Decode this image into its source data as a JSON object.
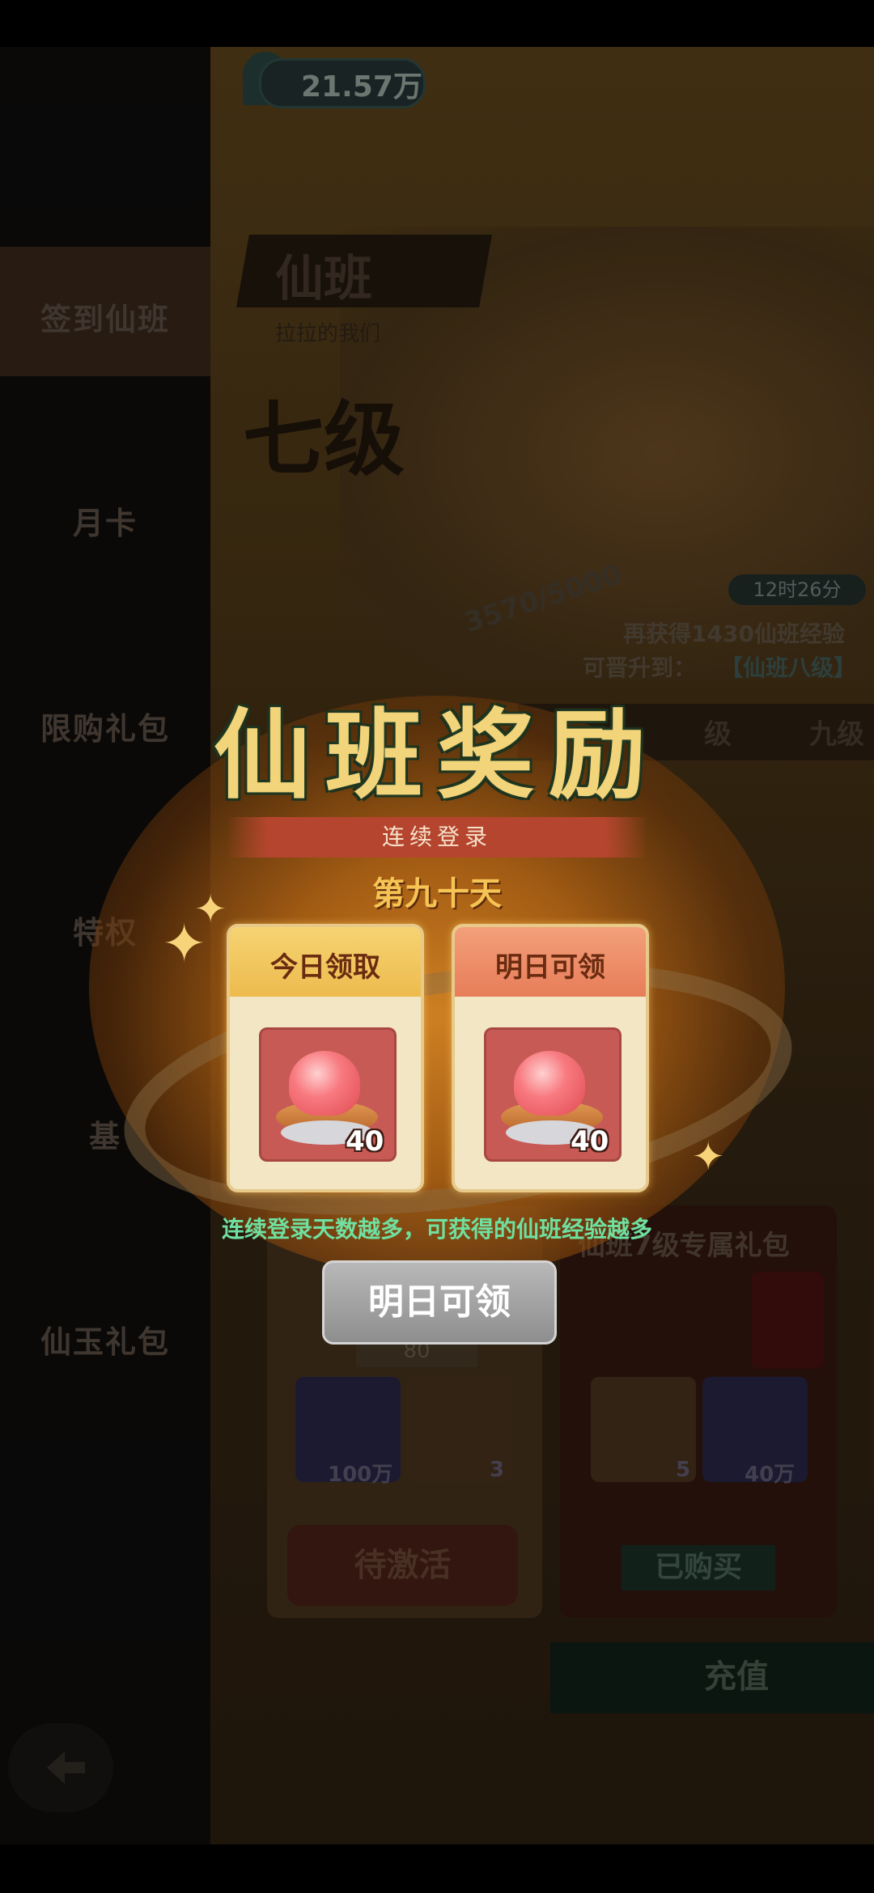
{
  "currency": {
    "value": "21.57万",
    "icon": "spiral-icon"
  },
  "sidebar": {
    "items": [
      {
        "label": "签到仙班"
      },
      {
        "label": "月卡"
      },
      {
        "label": "限购礼包"
      },
      {
        "label": "特权"
      },
      {
        "label": "基"
      },
      {
        "label": "仙玉礼包"
      }
    ]
  },
  "hero": {
    "badge": "仙班",
    "subtitle": "拉拉的我们",
    "level": "七级",
    "progress": "3570/5000",
    "timer": "12时26分",
    "exp_line": "再获得1430仙班经验",
    "promo_line": "可晋升到：",
    "promo_target": "【仙班八级】"
  },
  "tabs": {
    "eight": "级",
    "nine": "九级"
  },
  "panels": {
    "right_title": "仙班7级专属礼包",
    "left_price": "80",
    "tiles": [
      {
        "label": "100万"
      },
      {
        "label": "3"
      },
      {
        "label": "5"
      },
      {
        "label": "40万"
      }
    ],
    "pending_label": "待激活",
    "bought_label": "已购买",
    "recharge_label": "充值"
  },
  "modal": {
    "title": "仙班奖励",
    "banner": "连续登录",
    "day": "第九十天",
    "cards": [
      {
        "title": "今日领取",
        "quantity": "40",
        "item": "red-orb-pedestal"
      },
      {
        "title": "明日可领",
        "quantity": "40",
        "item": "red-orb-pedestal"
      }
    ],
    "hint": "连续登录天数越多，可获得的仙班经验越多",
    "button": "明日可领"
  }
}
